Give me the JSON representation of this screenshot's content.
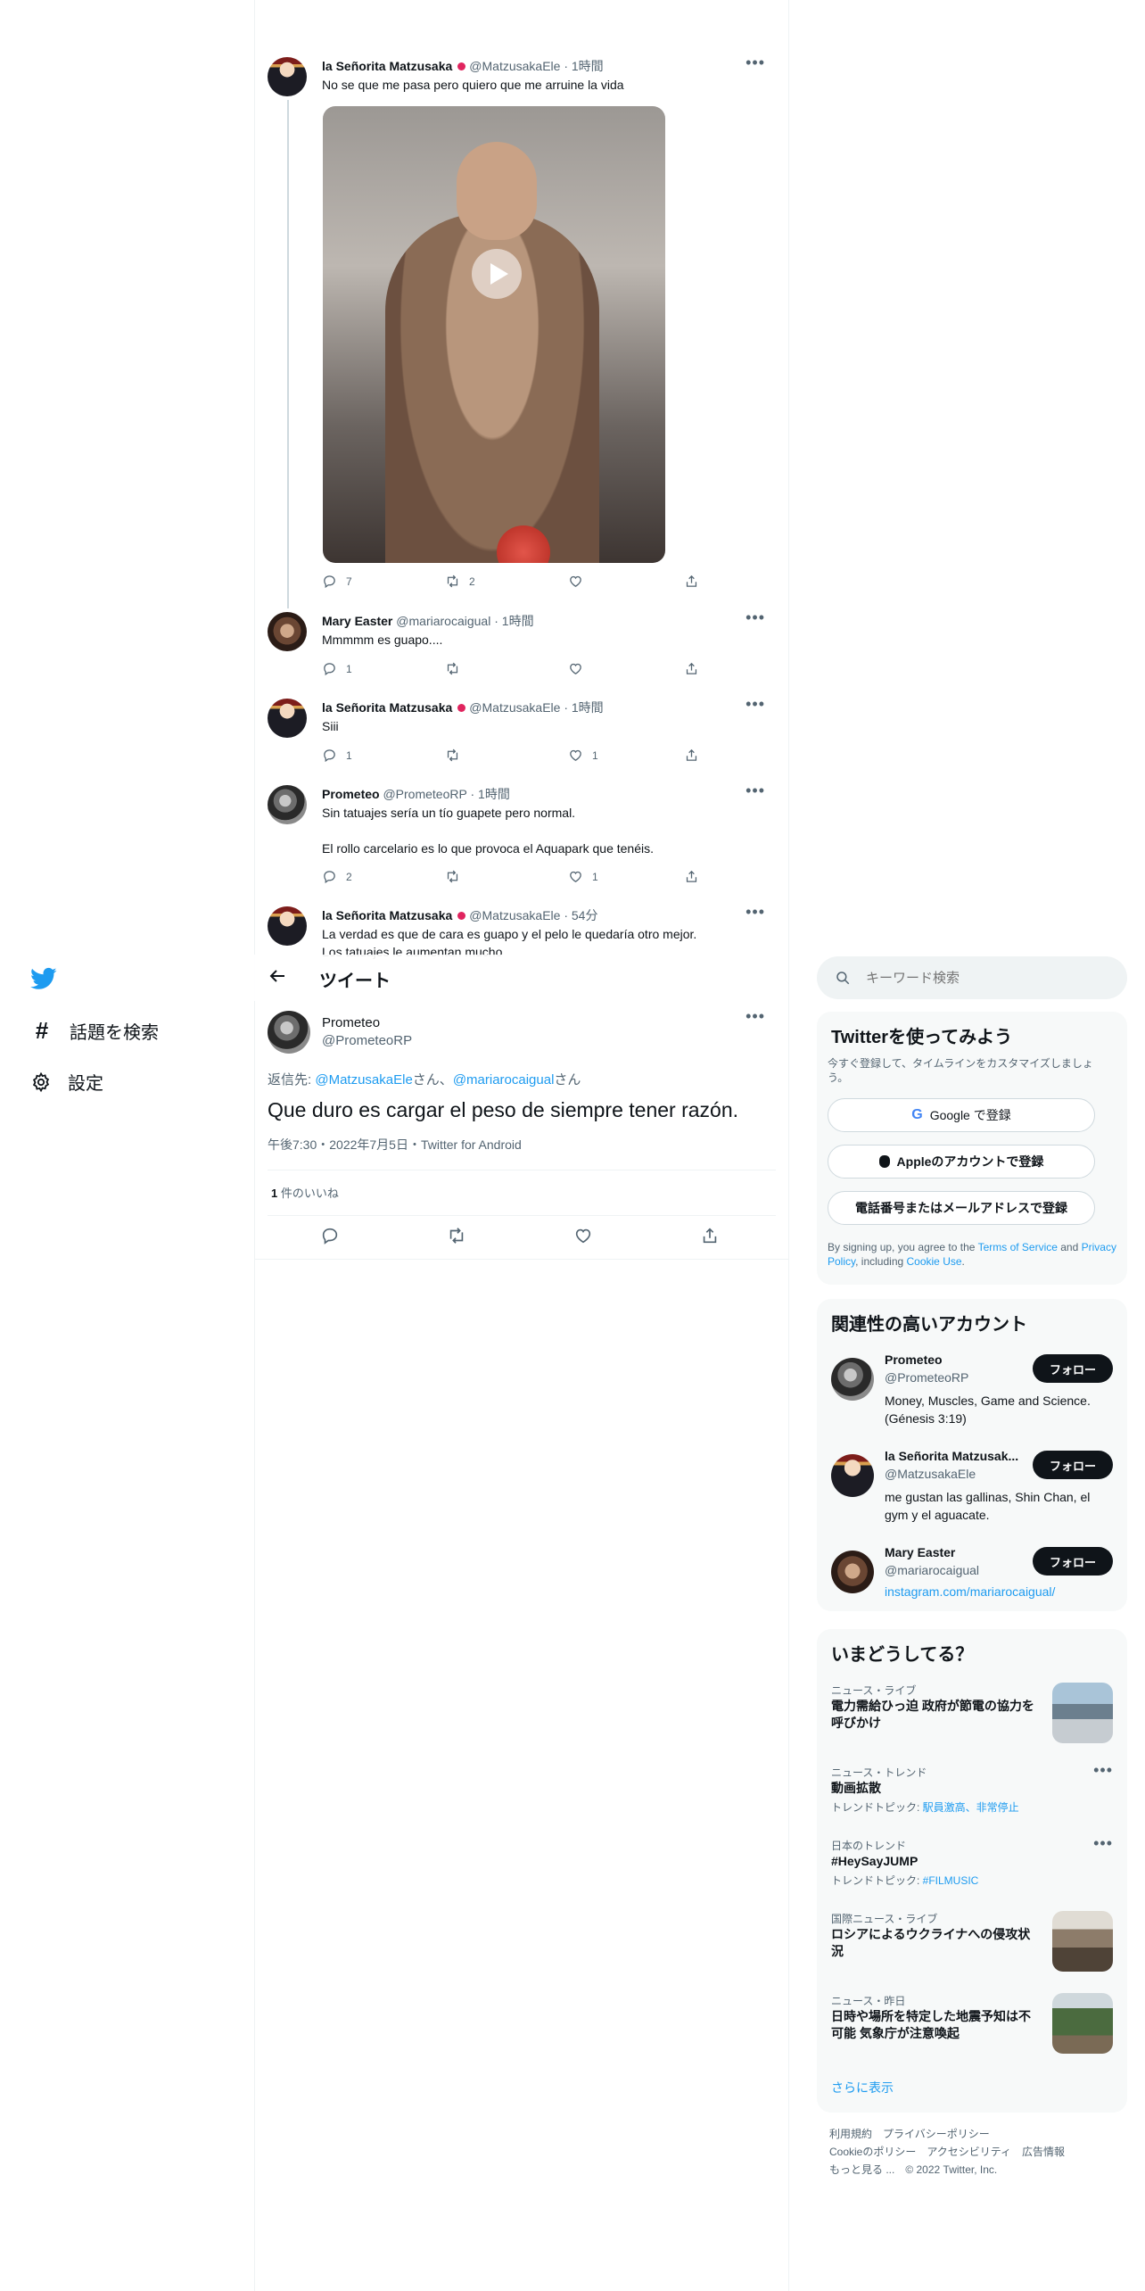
{
  "nav": {
    "explore": "話題を検索",
    "settings": "設定"
  },
  "timeline": {
    "tweets": [
      {
        "name": "la Señorita Matzusaka",
        "handle": "@MatzusakaEle",
        "time": "1時間",
        "text": "No se que me pasa pero quiero que me arruine la vida",
        "replies": "7",
        "retweets": "2",
        "likes": ""
      },
      {
        "name": "Mary Easter",
        "handle": "@mariarocaigual",
        "time": "1時間",
        "text": "Mmmmm es guapo....",
        "replies": "1",
        "retweets": "",
        "likes": ""
      },
      {
        "name": "la Señorita Matzusaka",
        "handle": "@MatzusakaEle",
        "time": "1時間",
        "text": "Siii",
        "replies": "1",
        "retweets": "",
        "likes": "1"
      },
      {
        "name": "Prometeo",
        "handle": "@PrometeoRP",
        "time": "1時間",
        "text": "Sin tatuajes sería un tío guapete pero normal.",
        "text2": "El rollo carcelario es lo que provoca el Aquapark que tenéis.",
        "replies": "2",
        "retweets": "",
        "likes": "1"
      },
      {
        "name": "la Señorita Matzusaka",
        "handle": "@MatzusakaEle",
        "time": "54分",
        "text": "La verdad es que de cara es guapo y el pelo le quedaría otro mejor.",
        "text2": "Los tatuajes le aumentan mucho"
      }
    ]
  },
  "header": {
    "title": "ツイート"
  },
  "main_tweet": {
    "name": "Prometeo",
    "handle": "@PrometeoRP",
    "reply_prefix": "返信先: ",
    "reply_to_1": "@MatzusakaEle",
    "san1": "さん、",
    "reply_to_2": "@mariarocaigual",
    "san2": "さん",
    "text": "Que duro es cargar el peso de siempre tener razón.",
    "meta": "午後7:30・2022年7月5日・Twitter for Android",
    "likes_count": "1",
    "likes_label": " 件のいいね"
  },
  "search": {
    "placeholder": "キーワード検索"
  },
  "signup": {
    "title": "Twitterを使ってみよう",
    "subtitle": "今すぐ登録して、タイムラインをカスタマイズしましょう。",
    "google": "Google で登録",
    "apple": "Appleのアカウントで登録",
    "phone": "電話番号またはメールアドレスで登録",
    "legal_1": "By signing up, you agree to the ",
    "terms": "Terms of Service",
    "legal_2": " and ",
    "privacy": "Privacy Policy",
    "legal_3": ", including ",
    "cookie": "Cookie Use",
    "legal_4": "."
  },
  "relevant": {
    "title": "関連性の高いアカウント",
    "follow_label": "フォロー",
    "accounts": [
      {
        "name": "Prometeo",
        "handle": "@PrometeoRP",
        "bio": "Money, Muscles, Game and Science. (Génesis 3:19)"
      },
      {
        "name": "la Señorita Matzusak...",
        "handle": "@MatzusakaEle",
        "bio": "me gustan las gallinas, Shin Chan, el gym y el aguacate."
      },
      {
        "name": "Mary Easter",
        "handle": "@mariarocaigual",
        "bio": "instagram.com/mariarocaigual/"
      }
    ]
  },
  "trends": {
    "title": "いまどうしてる？",
    "items": [
      {
        "category": "ニュース・ライブ",
        "title": "電力需給ひっ迫 政府が節電の協力を呼びかけ"
      },
      {
        "category": "ニュース・トレンド",
        "title": "動画拡散",
        "sub_label": "トレンドトピック: ",
        "sub_link": "駅員激高、非常停止"
      },
      {
        "category": "日本のトレンド",
        "title": "#HeySayJUMP",
        "sub_label": "トレンドトピック: ",
        "sub_link": "#FILMUSIC"
      },
      {
        "category": "国際ニュース・ライブ",
        "title": "ロシアによるウクライナへの侵攻状況"
      },
      {
        "category": "ニュース・昨日",
        "title": "日時や場所を特定した地震予知は不可能 気象庁が注意喚起"
      }
    ],
    "show_more": "さらに表示"
  },
  "footer": {
    "line1": "利用規約　プライバシーポリシー",
    "line2": "Cookieのポリシー　アクセシビリティ　広告情報",
    "line3": "もっと見る ...　© 2022 Twitter, Inc."
  }
}
